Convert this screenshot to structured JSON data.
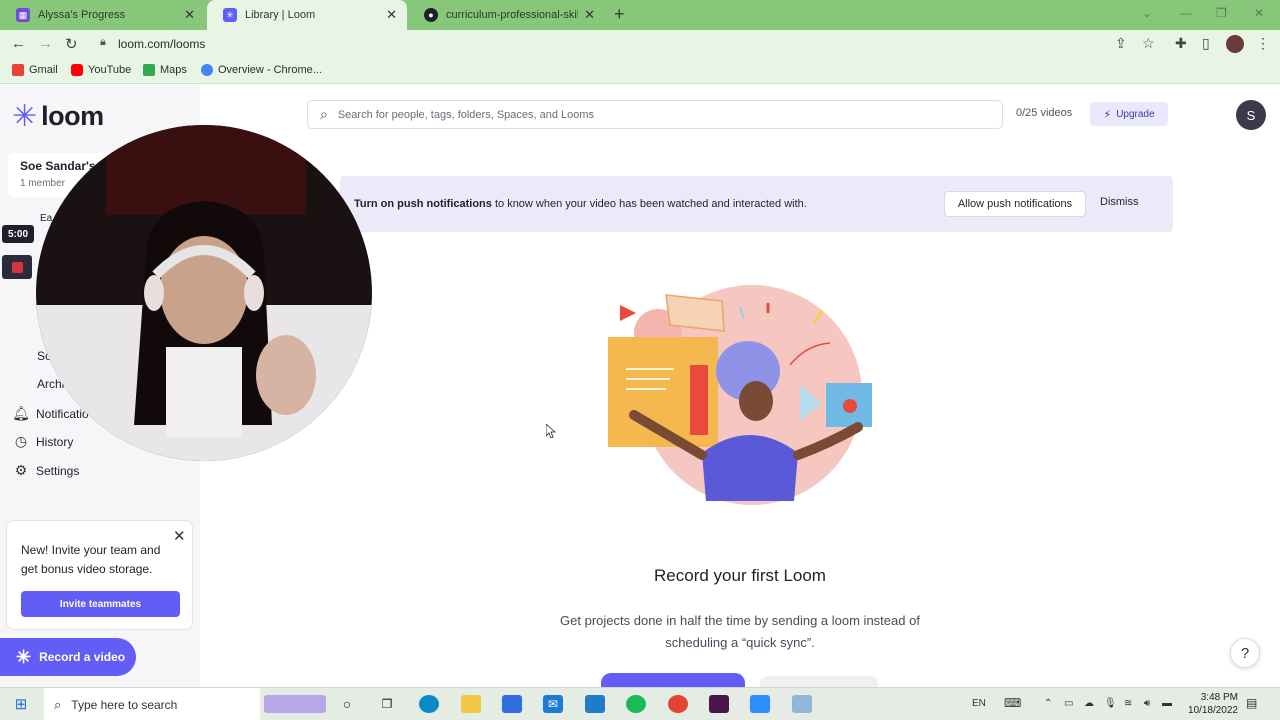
{
  "browser": {
    "tabs": [
      {
        "title": "Alyssa's Progress",
        "favicon_color": "#6e4cd6"
      },
      {
        "title": "Library | Loom",
        "favicon_color": "#625df5"
      },
      {
        "title": "curriculum-professional-skills/w",
        "favicon_color": "#1f2328"
      }
    ],
    "new_tab": "+",
    "url": "loom.com/looms",
    "bookmarks": [
      {
        "label": "Gmail",
        "color": "#ea4335"
      },
      {
        "label": "YouTube",
        "color": "#ff0000"
      },
      {
        "label": "Maps",
        "color": "#34a853"
      },
      {
        "label": "Overview - Chrome...",
        "color": "#4285f4"
      }
    ]
  },
  "sidebar": {
    "logo": "loom",
    "workspace_name": "Soe Sandar's W",
    "workspace_members": "1 member",
    "nav_partial": [
      "Ea",
      "Sc",
      "Archi"
    ],
    "nav_items": [
      {
        "label": "Notificatio",
        "icon": "bell-icon"
      },
      {
        "label": "History",
        "icon": "clock-icon"
      },
      {
        "label": "Settings",
        "icon": "gear-icon"
      }
    ],
    "promo": {
      "text": "New! Invite your team and get bonus video storage.",
      "button": "Invite teammates"
    },
    "record_button": "Record a video"
  },
  "header": {
    "search_placeholder": "Search for people, tags, folders, Spaces, and Looms",
    "videos_count": "0/25 videos",
    "upgrade": "Upgrade",
    "avatar_initial": "S"
  },
  "banner": {
    "bold": "Turn on push notifications",
    "rest": " to know when your video has been watched and interacted with.",
    "allow": "Allow push notifications",
    "dismiss": "Dismiss"
  },
  "empty_state": {
    "title": "Record your first Loom",
    "description": "Get projects done in half the time by sending a loom instead of scheduling a “quick sync”."
  },
  "recording": {
    "timer": "5:00"
  },
  "help": "?",
  "taskbar": {
    "search_placeholder": "Type here to search",
    "language": "EN",
    "time": "3:48 PM",
    "date": "10/18/2022"
  },
  "colors": {
    "brand": "#625df5",
    "tabbar": "#87c77a",
    "banner_bg": "#ebeaf9"
  }
}
